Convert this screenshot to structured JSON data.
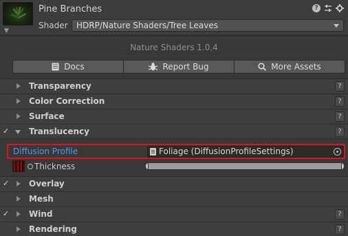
{
  "header": {
    "title": "Pine Branches",
    "shader_label": "Shader",
    "shader_value": "HDRP/Nature Shaders/Tree Leaves",
    "icons": [
      "help-icon",
      "presets-icon",
      "settings-icon"
    ]
  },
  "version": "Nature Shaders 1.0.4",
  "toolbar": {
    "docs": "Docs",
    "report_bug": "Report Bug",
    "more_assets": "More Assets"
  },
  "sections": {
    "transparency": {
      "label": "Transparency",
      "help": "?"
    },
    "color_correction": {
      "label": "Color Correction",
      "help": "?"
    },
    "surface": {
      "label": "Surface",
      "help": "?"
    },
    "translucency": {
      "label": "Translucency",
      "help": "?",
      "checked": true,
      "expanded": true
    },
    "overlay": {
      "label": "Overlay",
      "checked": true
    },
    "mesh": {
      "label": "Mesh"
    },
    "wind": {
      "label": "Wind",
      "help": "?",
      "checked": true
    },
    "rendering": {
      "label": "Rendering",
      "help": "?"
    }
  },
  "translucency": {
    "diffusion_label": "Diffusion Profile",
    "diffusion_value": "Foliage (DiffusionProfileSettings)",
    "thickness_label": "Thickness"
  },
  "colors": {
    "highlight": "#e0121b",
    "link_label": "#4e9ae6",
    "background": "#383838"
  }
}
